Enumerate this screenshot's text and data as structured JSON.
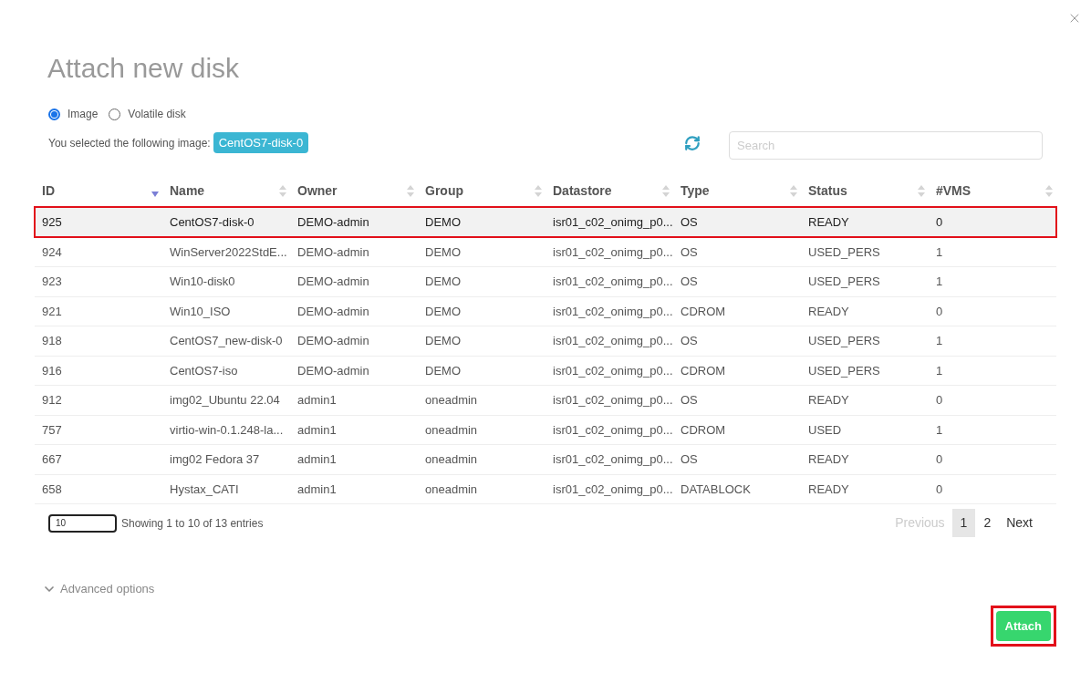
{
  "dialog": {
    "title": "Attach new disk"
  },
  "source_options": [
    {
      "label": "Image",
      "selected": true
    },
    {
      "label": "Volatile disk",
      "selected": false
    }
  ],
  "selection": {
    "label": "You selected the following image:",
    "value": "CentOS7-disk-0"
  },
  "search": {
    "placeholder": "Search"
  },
  "table": {
    "columns": [
      {
        "label": "ID",
        "sorted": true
      },
      {
        "label": "Name",
        "sorted": false
      },
      {
        "label": "Owner",
        "sorted": false
      },
      {
        "label": "Group",
        "sorted": false
      },
      {
        "label": "Datastore",
        "sorted": false
      },
      {
        "label": "Type",
        "sorted": false
      },
      {
        "label": "Status",
        "sorted": false
      },
      {
        "label": "#VMS",
        "sorted": false
      }
    ],
    "rows": [
      {
        "selected": true,
        "annotated": true,
        "cells": [
          "925",
          "CentOS7-disk-0",
          "DEMO-admin",
          "DEMO",
          "isr01_c02_onimg_p0...",
          "OS",
          "READY",
          "0"
        ]
      },
      {
        "selected": false,
        "annotated": false,
        "cells": [
          "924",
          "WinServer2022StdE...",
          "DEMO-admin",
          "DEMO",
          "isr01_c02_onimg_p0...",
          "OS",
          "USED_PERS",
          "1"
        ]
      },
      {
        "selected": false,
        "annotated": false,
        "cells": [
          "923",
          "Win10-disk0",
          "DEMO-admin",
          "DEMO",
          "isr01_c02_onimg_p0...",
          "OS",
          "USED_PERS",
          "1"
        ]
      },
      {
        "selected": false,
        "annotated": false,
        "cells": [
          "921",
          "Win10_ISO",
          "DEMO-admin",
          "DEMO",
          "isr01_c02_onimg_p0...",
          "CDROM",
          "READY",
          "0"
        ]
      },
      {
        "selected": false,
        "annotated": false,
        "cells": [
          "918",
          "CentOS7_new-disk-0",
          "DEMO-admin",
          "DEMO",
          "isr01_c02_onimg_p0...",
          "OS",
          "USED_PERS",
          "1"
        ]
      },
      {
        "selected": false,
        "annotated": false,
        "cells": [
          "916",
          "CentOS7-iso",
          "DEMO-admin",
          "DEMO",
          "isr01_c02_onimg_p0...",
          "CDROM",
          "USED_PERS",
          "1"
        ]
      },
      {
        "selected": false,
        "annotated": false,
        "cells": [
          "912",
          "img02_Ubuntu 22.04",
          "admin1",
          "oneadmin",
          "isr01_c02_onimg_p0...",
          "OS",
          "READY",
          "0"
        ]
      },
      {
        "selected": false,
        "annotated": false,
        "cells": [
          "757",
          "virtio-win-0.1.248-la...",
          "admin1",
          "oneadmin",
          "isr01_c02_onimg_p0...",
          "CDROM",
          "USED",
          "1"
        ]
      },
      {
        "selected": false,
        "annotated": false,
        "cells": [
          "667",
          "img02 Fedora 37",
          "admin1",
          "oneadmin",
          "isr01_c02_onimg_p0...",
          "OS",
          "READY",
          "0"
        ]
      },
      {
        "selected": false,
        "annotated": false,
        "cells": [
          "658",
          "Hystax_CATI",
          "admin1",
          "oneadmin",
          "isr01_c02_onimg_p0...",
          "DATABLOCK",
          "READY",
          "0"
        ]
      }
    ]
  },
  "page_size": {
    "value": "10"
  },
  "entries_info": "Showing 1 to 10 of 13 entries",
  "pagination": {
    "previous": {
      "label": "Previous",
      "disabled": true
    },
    "pages": [
      {
        "label": "1",
        "selected": true
      },
      {
        "label": "2",
        "selected": false
      }
    ],
    "next": {
      "label": "Next",
      "disabled": false
    }
  },
  "advanced_options": {
    "label": "Advanced options",
    "expanded": false
  },
  "attach_button": {
    "label": "Attach",
    "annotated": true
  }
}
